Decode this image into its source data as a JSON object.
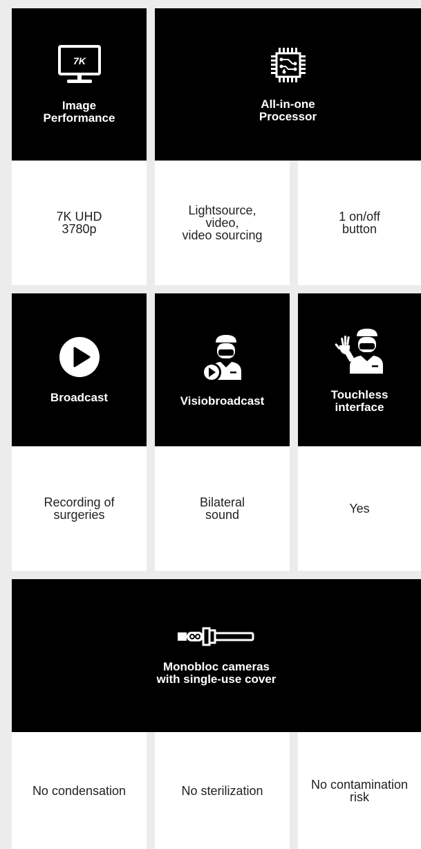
{
  "row1": {
    "image_performance": {
      "title": "Image\nPerformance",
      "icon": "monitor-7k-icon",
      "badge": "7K"
    },
    "processor": {
      "title": "All-in-one\nProcessor",
      "icon": "chip-icon"
    }
  },
  "row1_values": [
    "7K UHD\n3780p",
    "Lightsource,\nvideo,\nvideo sourcing",
    "1 on/off\nbutton"
  ],
  "row2": {
    "broadcast": {
      "title": "Broadcast",
      "icon": "play-icon"
    },
    "visiobroadcast": {
      "title": "Visiobroadcast",
      "icon": "surgeon-play-icon"
    },
    "touchless": {
      "title": "Touchless\ninterface",
      "icon": "surgeon-wave-icon"
    }
  },
  "row2_values": [
    "Recording of\nsurgeries",
    "Bilateral\nsound",
    "Yes"
  ],
  "row3": {
    "cameras": {
      "title": "Monobloc cameras\nwith single-use cover",
      "icon": "camera-probe-icon"
    }
  },
  "row3_values": [
    "No condensation",
    "No sterilization",
    "No contamination\nrisk"
  ],
  "colors": {
    "background": "#ececec",
    "tile_dark": "#000000",
    "tile_light": "#ffffff",
    "text": "#222222"
  }
}
